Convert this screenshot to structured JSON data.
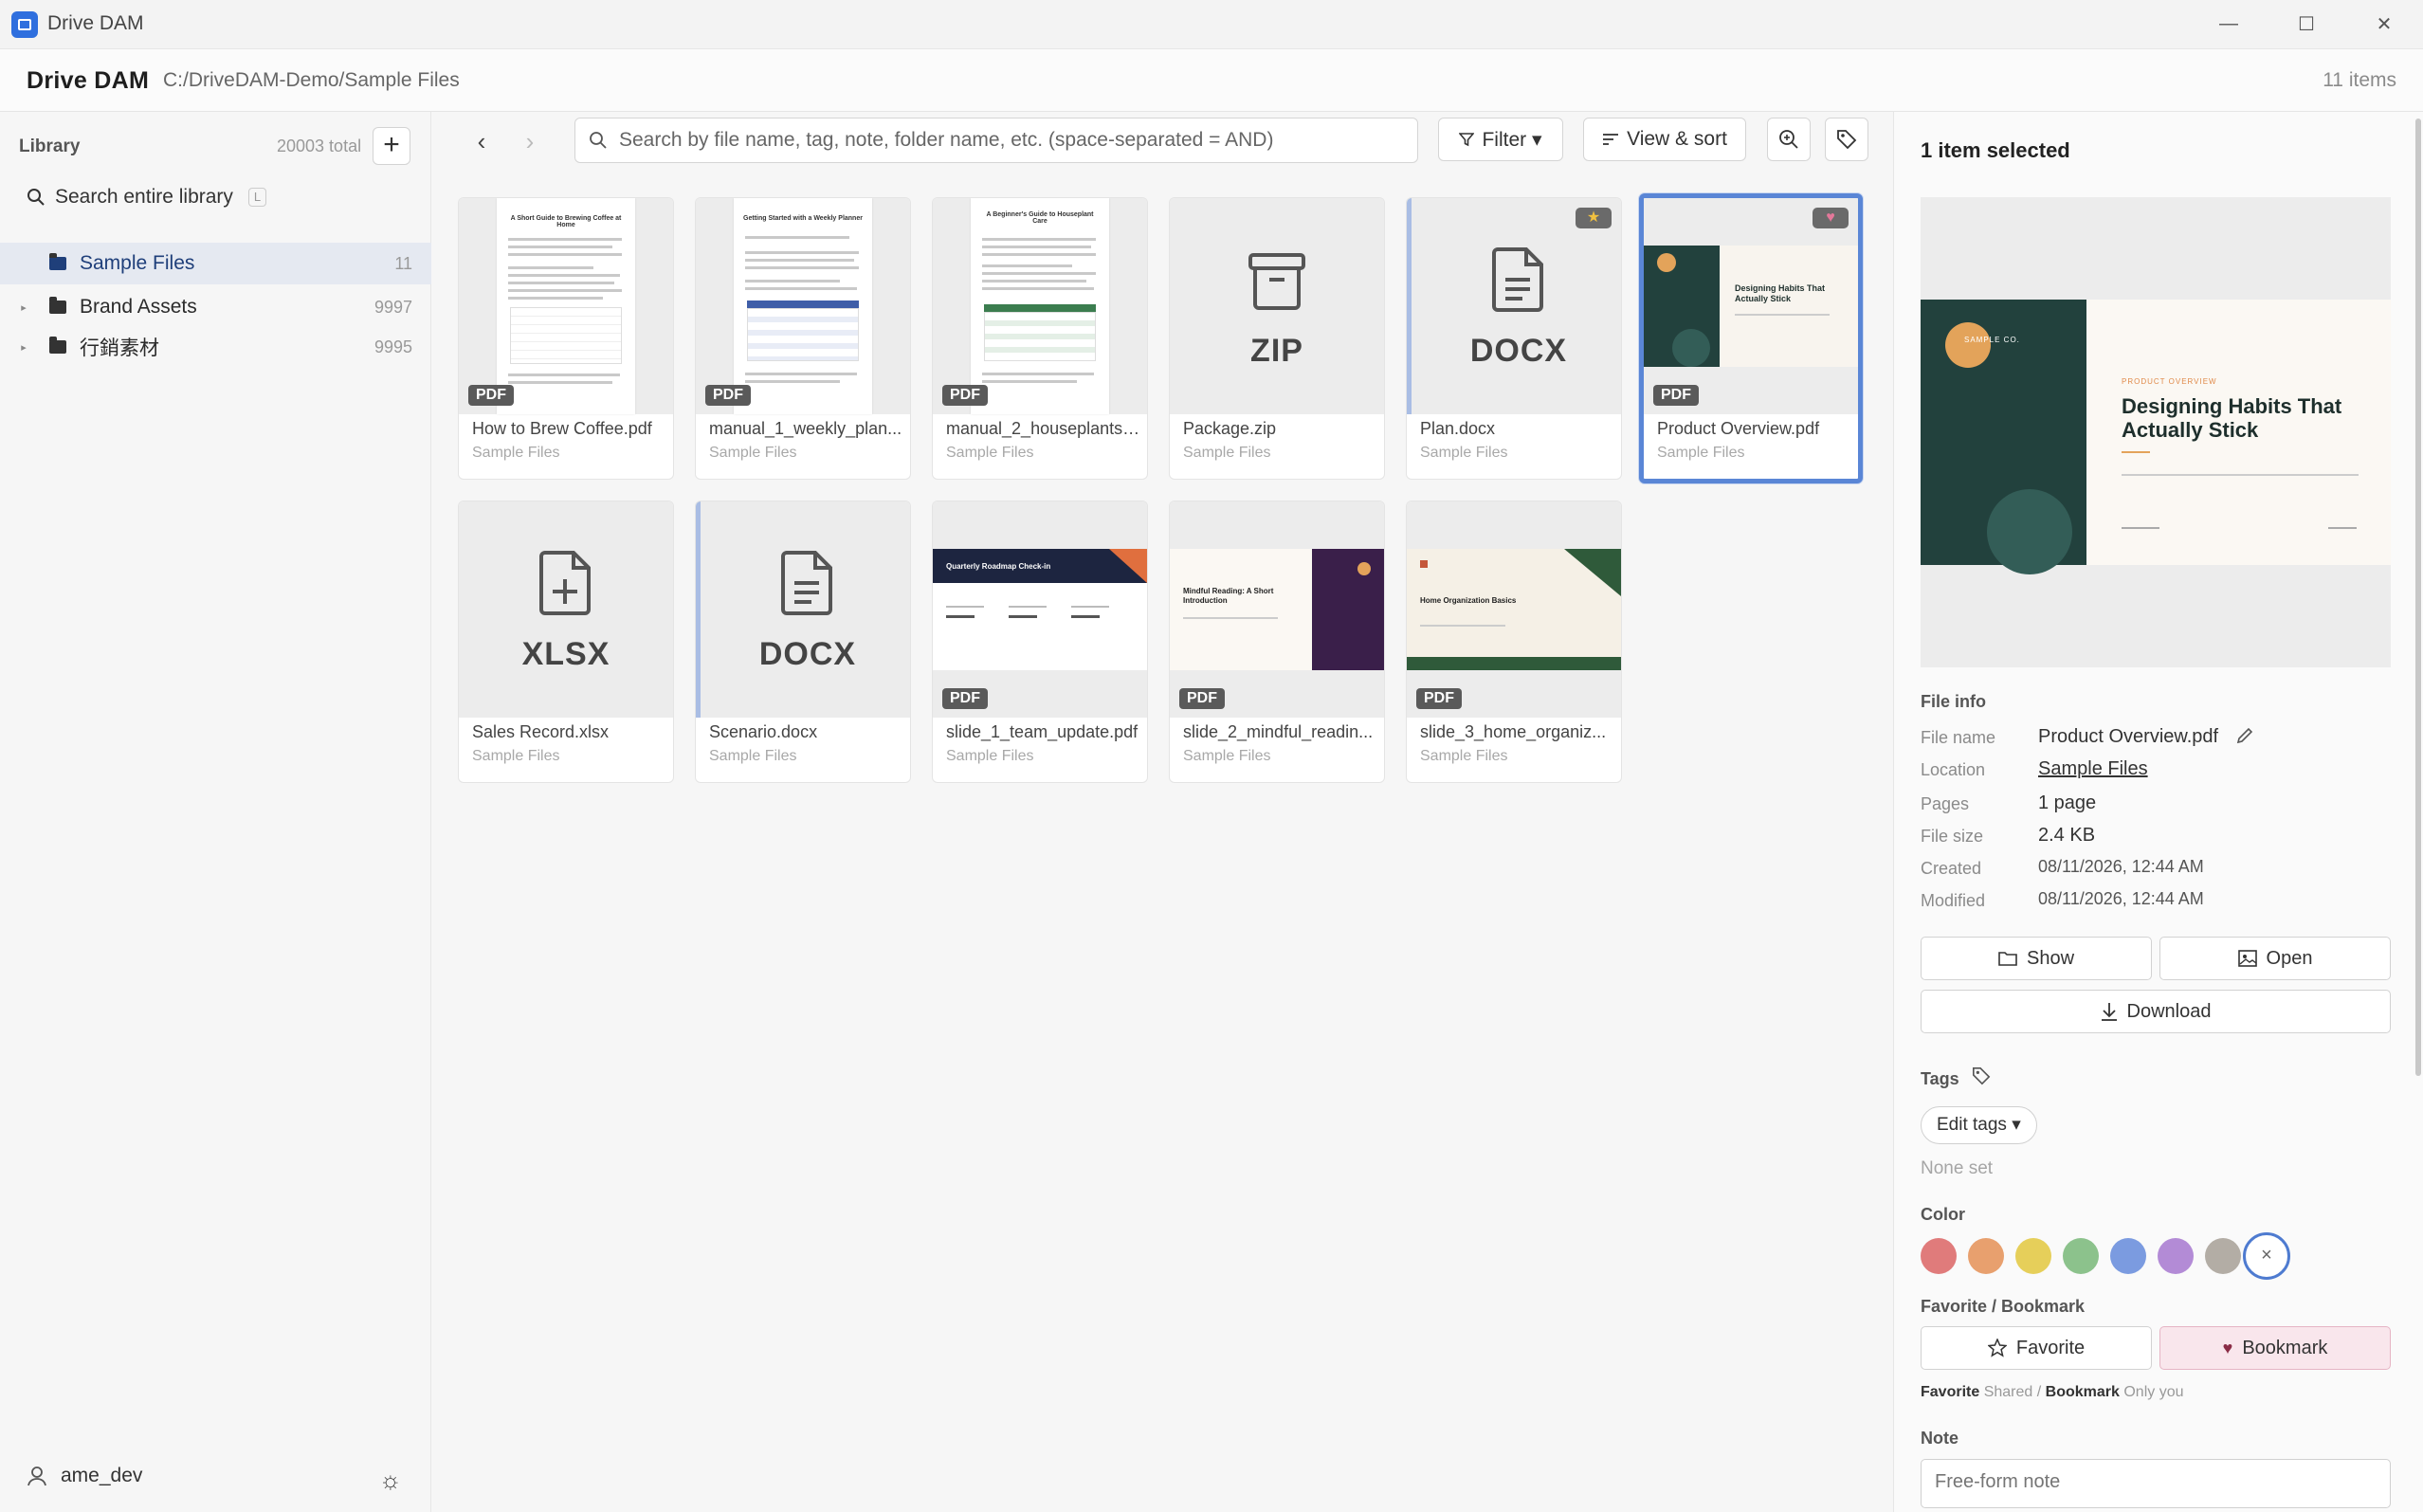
{
  "window": {
    "title": "Drive DAM",
    "min_icon": "—",
    "max_icon": "☐",
    "close_icon": "✕"
  },
  "header": {
    "app_name": "Drive DAM",
    "path": "C:/DriveDAM-Demo/Sample Files",
    "item_count": "11 items"
  },
  "sidebar": {
    "library_label": "Library",
    "total": "20003 total",
    "add_label": "+",
    "search_label": "Search entire library",
    "search_shortcut": "L",
    "tree": [
      {
        "label": "Sample Files",
        "count": "11"
      },
      {
        "label": "Brand Assets",
        "count": "9997"
      },
      {
        "label": "行銷素材",
        "count": "9995"
      }
    ],
    "user": "ame_dev"
  },
  "toolbar": {
    "search_placeholder": "Search by file name, tag, note, folder name, etc. (space-separated = AND)",
    "filter_label": "Filter ▾",
    "view_sort_label": "View & sort"
  },
  "files": [
    {
      "name": "How to Brew Coffee.pdf",
      "location": "Sample Files",
      "badge": "PDF",
      "doc_title": "A Short Guide to Brewing Coffee at Home"
    },
    {
      "name": "manual_1_weekly_plan...",
      "location": "Sample Files",
      "badge": "PDF",
      "doc_title": "Getting Started with a Weekly Planner"
    },
    {
      "name": "manual_2_houseplants....",
      "location": "Sample Files",
      "badge": "PDF",
      "doc_title": "A Beginner's Guide to Houseplant Care"
    },
    {
      "name": "Package.zip",
      "location": "Sample Files",
      "type": "ZIP"
    },
    {
      "name": "Plan.docx",
      "location": "Sample Files",
      "type": "DOCX",
      "star": "★"
    },
    {
      "name": "Product Overview.pdf",
      "location": "Sample Files",
      "badge": "PDF",
      "heart": "♥",
      "slide_title": "Designing Habits That Actually Stick"
    },
    {
      "name": "Sales Record.xlsx",
      "location": "Sample Files",
      "type": "XLSX"
    },
    {
      "name": "Scenario.docx",
      "location": "Sample Files",
      "type": "DOCX"
    },
    {
      "name": "slide_1_team_update.pdf",
      "location": "Sample Files",
      "badge": "PDF",
      "slide_title": "Quarterly Roadmap Check-in"
    },
    {
      "name": "slide_2_mindful_readin...",
      "location": "Sample Files",
      "badge": "PDF",
      "slide_title": "Mindful Reading: A Short Introduction"
    },
    {
      "name": "slide_3_home_organiz...",
      "location": "Sample Files",
      "badge": "PDF",
      "slide_title": "Home Organization Basics"
    }
  ],
  "details": {
    "selected_label": "1 item selected",
    "preview_title": "Designing Habits That Actually Stick",
    "preview_kicker": "PRODUCT OVERVIEW",
    "preview_logo": "SAMPLE CO.",
    "file_info_label": "File info",
    "info": [
      {
        "key": "File name",
        "value": "Product Overview.pdf"
      },
      {
        "key": "Location",
        "value": "Sample Files"
      },
      {
        "key": "Pages",
        "value": "1 page"
      },
      {
        "key": "File size",
        "value": "2.4 KB"
      },
      {
        "key": "Created",
        "value": "08/11/2026, 12:44 AM"
      },
      {
        "key": "Modified",
        "value": "08/11/2026, 12:44 AM"
      }
    ],
    "show_label": "Show",
    "open_label": "Open",
    "download_label": "Download",
    "tags_label": "Tags",
    "edit_tags_label": "Edit tags ▾",
    "tags_none": "None set",
    "color_label": "Color",
    "colors": [
      "#e07b7b",
      "#e8a06e",
      "#e6cf5a",
      "#8cc28c",
      "#7b9be0",
      "#b38bd6",
      "#b3ada5"
    ],
    "color_clear": "×",
    "fav_section_label": "Favorite / Bookmark",
    "favorite_label": "Favorite",
    "bookmark_label": "Bookmark",
    "fav_note_fav": "Favorite",
    "fav_note_shared": "Shared /",
    "fav_note_bm": "Bookmark",
    "fav_note_only": "Only you",
    "note_label": "Note",
    "note_placeholder": "Free-form note"
  }
}
